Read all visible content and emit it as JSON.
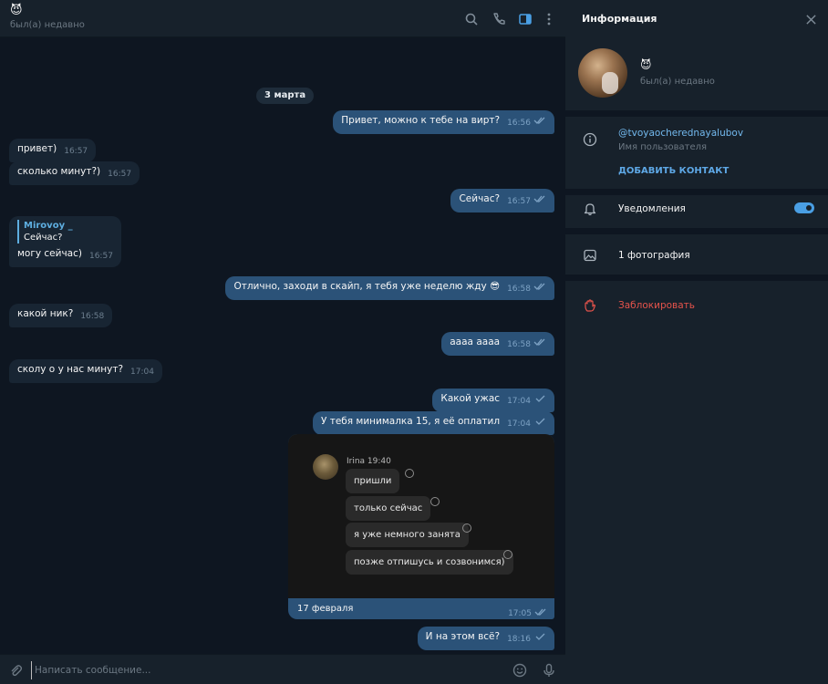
{
  "header": {
    "peer_emoji": "😈",
    "peer_status": "был(а) недавно"
  },
  "chat": {
    "date": "3 марта",
    "messages": [
      {
        "text": "Привет, можно к тебе на вирт?",
        "time": "16:56"
      },
      {
        "text": "привет)",
        "time": "16:57"
      },
      {
        "text": "сколько минут?)",
        "time": "16:57"
      },
      {
        "text": "Сейчас?",
        "time": "16:57"
      },
      {
        "reply_name": "Mirovoy _",
        "reply_text": "Сейчас?",
        "text": "могу сейчас)",
        "time": "16:57"
      },
      {
        "text": "Отлично, заходи в скайп, я тебя уже неделю жду 😎",
        "time": "16:58"
      },
      {
        "text": "какой ник?",
        "time": "16:58"
      },
      {
        "text": "аааа аааа",
        "time": "16:58"
      },
      {
        "text": "сколу о у нас минут?",
        "time": "17:04"
      },
      {
        "text": "Какой ужас",
        "time": "17:04"
      },
      {
        "text": "У тебя минималка 15, я её оплатил",
        "time": "17:04"
      },
      {
        "text": "И на этом всё?",
        "time": "18:16"
      }
    ],
    "photo": {
      "sender_line": "Irina 19:40",
      "bubbles": [
        "пришли",
        "только сейчас",
        "я уже немного занята",
        "позже отпишусь и созвонимся)"
      ],
      "caption": "17 февраля",
      "time": "17:05"
    }
  },
  "composer": {
    "placeholder": "Написать сообщение..."
  },
  "info": {
    "title": "Информация",
    "name_emoji": "😈",
    "status": "был(а) недавно",
    "username": "@tvoyaocherednayalubov",
    "username_label": "Имя пользователя",
    "add_contact": "ДОБАВИТЬ КОНТАКТ",
    "notifications": "Уведомления",
    "notifications_enabled": true,
    "photos": "1 фотография",
    "block": "Заблокировать"
  },
  "colors": {
    "bg": "#0e1621",
    "panel": "#17212b",
    "outgoing": "#2b5278",
    "incoming": "#182533",
    "accent": "#5ea8e6",
    "danger": "#e5534b"
  }
}
